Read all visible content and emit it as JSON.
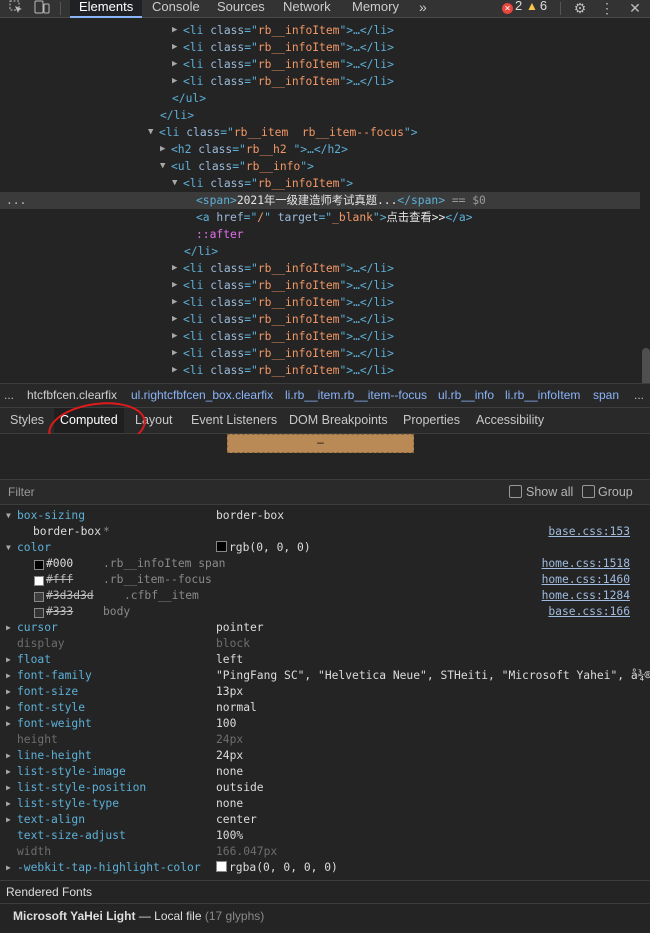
{
  "toolbar": {
    "tabs": [
      "Elements",
      "Console",
      "Sources",
      "Network",
      "Memory"
    ],
    "active_tab": "Elements",
    "more": "»",
    "errors": "2",
    "warnings": "6"
  },
  "tree": {
    "lines": [
      {
        "ind": 174,
        "open": false,
        "tag": "li",
        "cls": "rb__infoItem",
        "tail": "…</li>"
      },
      {
        "ind": 174,
        "open": false,
        "tag": "li",
        "cls": "rb__infoItem",
        "tail": "…</li>"
      },
      {
        "ind": 174,
        "open": false,
        "tag": "li",
        "cls": "rb__infoItem",
        "tail": "…</li>"
      },
      {
        "ind": 174,
        "open": false,
        "tag": "li",
        "cls": "rb__infoItem",
        "tail": "…</li>"
      },
      {
        "ind": 172,
        "close": "</ul>"
      },
      {
        "ind": 160,
        "close": "</li>"
      },
      {
        "ind": 150,
        "open": true,
        "tag": "li",
        "cls": "rb__item  rb__item--focus",
        "tail": ""
      },
      {
        "ind": 162,
        "open": false,
        "tag": "h2",
        "cls": "rb__h2 ",
        "tail": "…</h2>"
      },
      {
        "ind": 162,
        "open": true,
        "tag": "ul",
        "cls": "rb__info",
        "tail": ""
      },
      {
        "ind": 174,
        "open": true,
        "tag": "li",
        "cls": "rb__infoItem",
        "tail": ""
      },
      {
        "ind": 196,
        "selected": true,
        "span_text": "2021年一级建造师考试真题...",
        "eq": "== $0"
      },
      {
        "ind": 196,
        "link": true,
        "href": "/",
        "target": "_blank",
        "link_text": "点击查看>>"
      },
      {
        "ind": 196,
        "pseudo": "::after"
      },
      {
        "ind": 184,
        "close": "</li>"
      },
      {
        "ind": 174,
        "open": false,
        "tag": "li",
        "cls": "rb__infoItem",
        "tail": "…</li>"
      },
      {
        "ind": 174,
        "open": false,
        "tag": "li",
        "cls": "rb__infoItem",
        "tail": "…</li>"
      },
      {
        "ind": 174,
        "open": false,
        "tag": "li",
        "cls": "rb__infoItem",
        "tail": "…</li>"
      },
      {
        "ind": 174,
        "open": false,
        "tag": "li",
        "cls": "rb__infoItem",
        "tail": "…</li>"
      },
      {
        "ind": 174,
        "open": false,
        "tag": "li",
        "cls": "rb__infoItem",
        "tail": "…</li>"
      },
      {
        "ind": 174,
        "open": false,
        "tag": "li",
        "cls": "rb__infoItem",
        "tail": "…</li>"
      },
      {
        "ind": 174,
        "open": false,
        "tag": "li",
        "cls": "rb__infoItem",
        "tail": "…</li>"
      }
    ],
    "ellipsis": "..."
  },
  "breadcrumbs": {
    "left_ellipsis": "...",
    "items": [
      "htcfbfcen.clearfix",
      "ul.rightcfbfcen_box.clearfix",
      "li.rb__item.rb__item--focus",
      "ul.rb__info",
      "li.rb__infoItem",
      "span"
    ],
    "right_ellipsis": "..."
  },
  "panel_tabs": {
    "items": [
      "Styles",
      "Computed",
      "Layout",
      "Event Listeners",
      "DOM Breakpoints",
      "Properties",
      "Accessibility"
    ],
    "active": "Computed"
  },
  "box_model": {
    "content": "–"
  },
  "filter": {
    "placeholder": "Filter",
    "show_all": "Show all",
    "group": "Group"
  },
  "computed": [
    {
      "name": "box-sizing",
      "value": "border-box",
      "expand": "down",
      "subs": [
        {
          "value": "border-box",
          "selector": "*",
          "source": "base.css:153"
        }
      ]
    },
    {
      "name": "color",
      "value": "rgb(0, 0, 0)",
      "swatch": "#000000",
      "expand": "down",
      "subs": [
        {
          "value": "#000",
          "swatch": "#000000",
          "selector": ".rb__infoItem span",
          "source": "home.css:1518"
        },
        {
          "value": "#fff",
          "swatch": "#ffffff",
          "strike": true,
          "selector": ".rb__item--focus",
          "source": "home.css:1460"
        },
        {
          "value": "#3d3d3d",
          "swatch": "#3d3d3d",
          "strike": true,
          "selector": ".cfbf__item",
          "source": "home.css:1284"
        },
        {
          "value": "#333",
          "swatch": "#333333",
          "strike": true,
          "selector": "body",
          "source": "base.css:166"
        }
      ]
    },
    {
      "name": "cursor",
      "value": "pointer",
      "expand": "right"
    },
    {
      "name": "display",
      "value": "block",
      "inherited": true
    },
    {
      "name": "float",
      "value": "left",
      "expand": "right"
    },
    {
      "name": "font-family",
      "value": "\"PingFang SC\", \"Helvetica Neue\", STHeiti, \"Microsoft Yahei\", å¾®",
      "expand": "right"
    },
    {
      "name": "font-size",
      "value": "13px",
      "expand": "right"
    },
    {
      "name": "font-style",
      "value": "normal",
      "expand": "right"
    },
    {
      "name": "font-weight",
      "value": "100",
      "expand": "right"
    },
    {
      "name": "height",
      "value": "24px",
      "inherited": true
    },
    {
      "name": "line-height",
      "value": "24px",
      "expand": "right"
    },
    {
      "name": "list-style-image",
      "value": "none",
      "expand": "right"
    },
    {
      "name": "list-style-position",
      "value": "outside",
      "expand": "right"
    },
    {
      "name": "list-style-type",
      "value": "none",
      "expand": "right"
    },
    {
      "name": "text-align",
      "value": "center",
      "expand": "right"
    },
    {
      "name": "text-size-adjust",
      "value": "100%"
    },
    {
      "name": "width",
      "value": "166.047px",
      "inherited": true
    },
    {
      "name": "-webkit-tap-highlight-color",
      "value": "rgba(0, 0, 0, 0)",
      "swatch": "#ffffff",
      "expand": "right"
    }
  ],
  "rendered_fonts": {
    "heading": "Rendered Fonts",
    "font_name": "Microsoft YaHei Light",
    "dash": "—",
    "origin": "Local file",
    "glyphs": "(17 glyphs)"
  },
  "colors": {
    "accent": "#8ab4f8",
    "annotation": "#e01b1b"
  }
}
